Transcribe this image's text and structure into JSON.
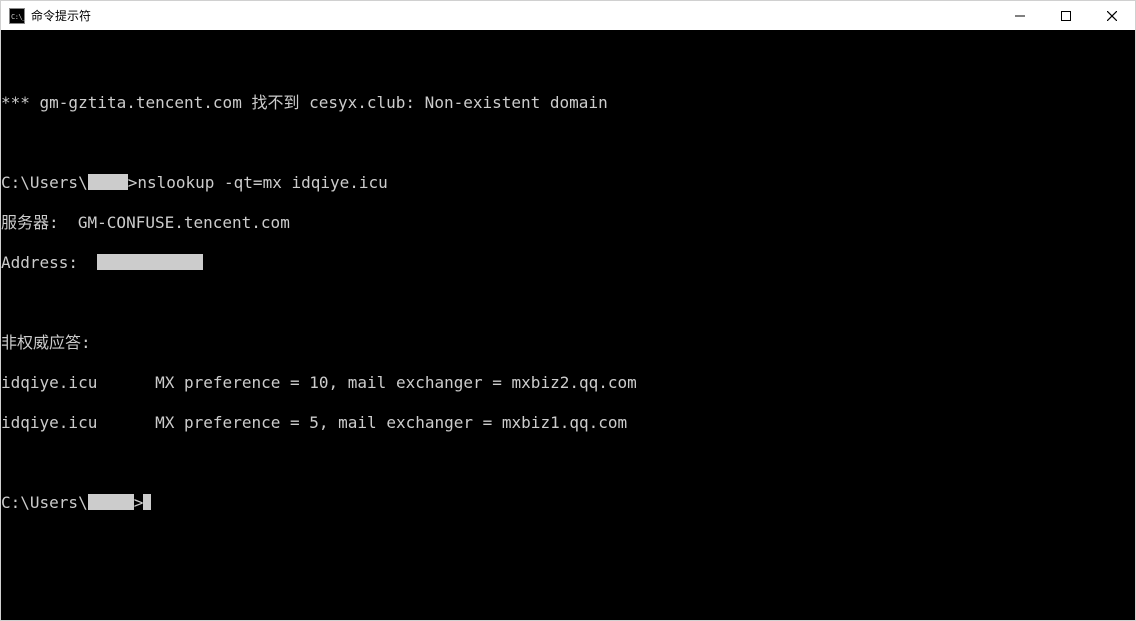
{
  "window": {
    "title": "命令提示符",
    "icon_label": "cmd-icon",
    "icon_text": "C:\\_"
  },
  "controls": {
    "min_label": "minimize",
    "max_label": "maximize",
    "close_label": "close"
  },
  "terminal": {
    "err_prefix": "*** gm-gztita.tencent.com 找不到 cesyx.club: Non-existent domain",
    "prompt1_pre": "C:\\Users\\",
    "prompt1_post": ">nslookup -qt=mx idqiye.icu",
    "server_label": "服务器:  GM-CONFUSE.tencent.com",
    "address_label": "Address:  ",
    "nonauth_label": "非权威应答:",
    "mx1": "idqiye.icu      MX preference = 10, mail exchanger = mxbiz2.qq.com",
    "mx2": "idqiye.icu      MX preference = 5, mail exchanger = mxbiz1.qq.com",
    "prompt2_pre": "C:\\Users\\",
    "prompt2_post": ">"
  }
}
